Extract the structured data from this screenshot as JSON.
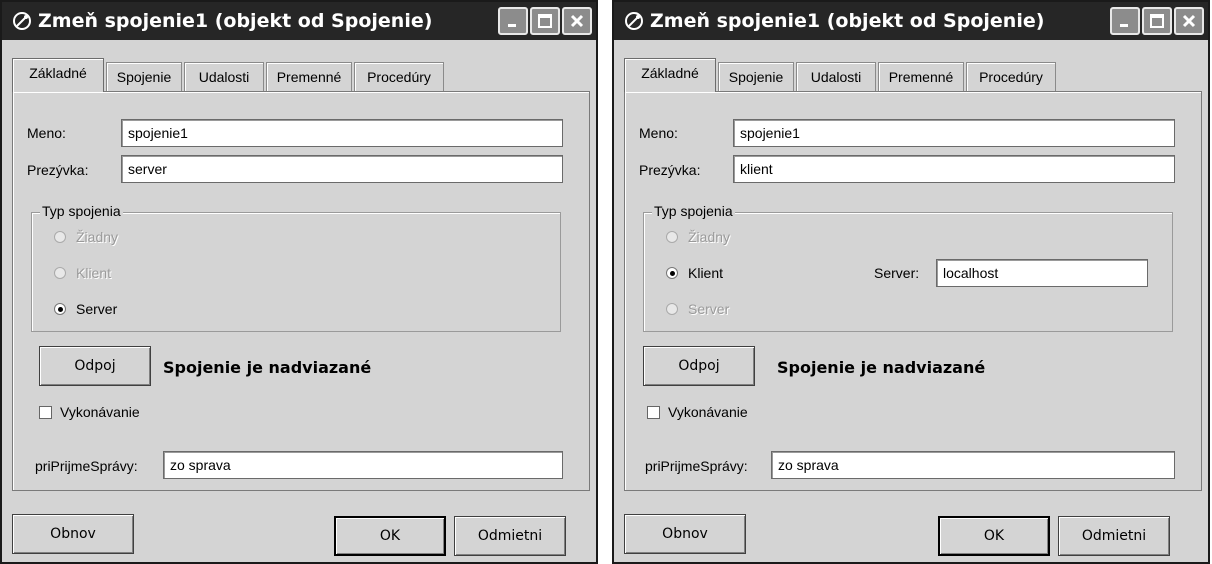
{
  "dialogs": [
    {
      "title": "Zmeň spojenie1 (objekt od Spojenie)",
      "tabs": [
        "Základné",
        "Spojenie",
        "Udalosti",
        "Premenné",
        "Procedúry"
      ],
      "active_tab": "Základné",
      "meno_label": "Meno:",
      "meno_value": "spojenie1",
      "prezyvka_label": "Prezývka:",
      "prezyvka_value": "server",
      "group_title": "Typ spojenia",
      "radio_ziadny": "Žiadny",
      "radio_klient": "Klient",
      "radio_server": "Server",
      "selected_type": "Server",
      "server_label": "",
      "server_value": "",
      "odpoj_label": "Odpoj",
      "status_text": "Spojenie je nadviazané",
      "vykonavanie_label": "Vykonávanie",
      "vykonavanie_checked": false,
      "prijem_label": "priPrijmeSprávy:",
      "prijem_value": "zo sprava",
      "obnov_label": "Obnov",
      "ok_label": "OK",
      "odmietni_label": "Odmietni"
    },
    {
      "title": "Zmeň spojenie1 (objekt od Spojenie)",
      "tabs": [
        "Základné",
        "Spojenie",
        "Udalosti",
        "Premenné",
        "Procedúry"
      ],
      "active_tab": "Základné",
      "meno_label": "Meno:",
      "meno_value": "spojenie1",
      "prezyvka_label": "Prezývka:",
      "prezyvka_value": "klient",
      "group_title": "Typ spojenia",
      "radio_ziadny": "Žiadny",
      "radio_klient": "Klient",
      "radio_server": "Server",
      "selected_type": "Klient",
      "server_label": "Server:",
      "server_value": "localhost",
      "odpoj_label": "Odpoj",
      "status_text": "Spojenie je nadviazané",
      "vykonavanie_label": "Vykonávanie",
      "vykonavanie_checked": false,
      "prijem_label": "priPrijmeSprávy:",
      "prijem_value": "zo sprava",
      "obnov_label": "Obnov",
      "ok_label": "OK",
      "odmietni_label": "Odmietni"
    }
  ]
}
